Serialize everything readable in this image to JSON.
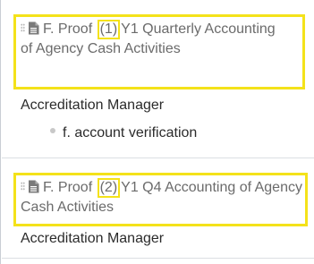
{
  "items": [
    {
      "title_prefix": "F. Proof",
      "number": "(1)",
      "title_suffix": "Y1 Quarterly Accounting of Agency Cash Activities",
      "role": "Accreditation Manager",
      "sub_items": [
        "f. account verification"
      ]
    },
    {
      "title_prefix": "F. Proof",
      "number": "(2)",
      "title_suffix": "Y1 Q4 Accounting of Agency Cash Activities",
      "role": "Accreditation Manager"
    }
  ],
  "icons": {
    "drag_handle": "drag-handle-icon",
    "document": "document-icon",
    "bullet": "bullet-icon"
  },
  "colors": {
    "highlight": "#f4e21a",
    "title_text": "#6b6b6b",
    "body_text": "#2b2b2b",
    "divider": "#dcdfe3"
  }
}
